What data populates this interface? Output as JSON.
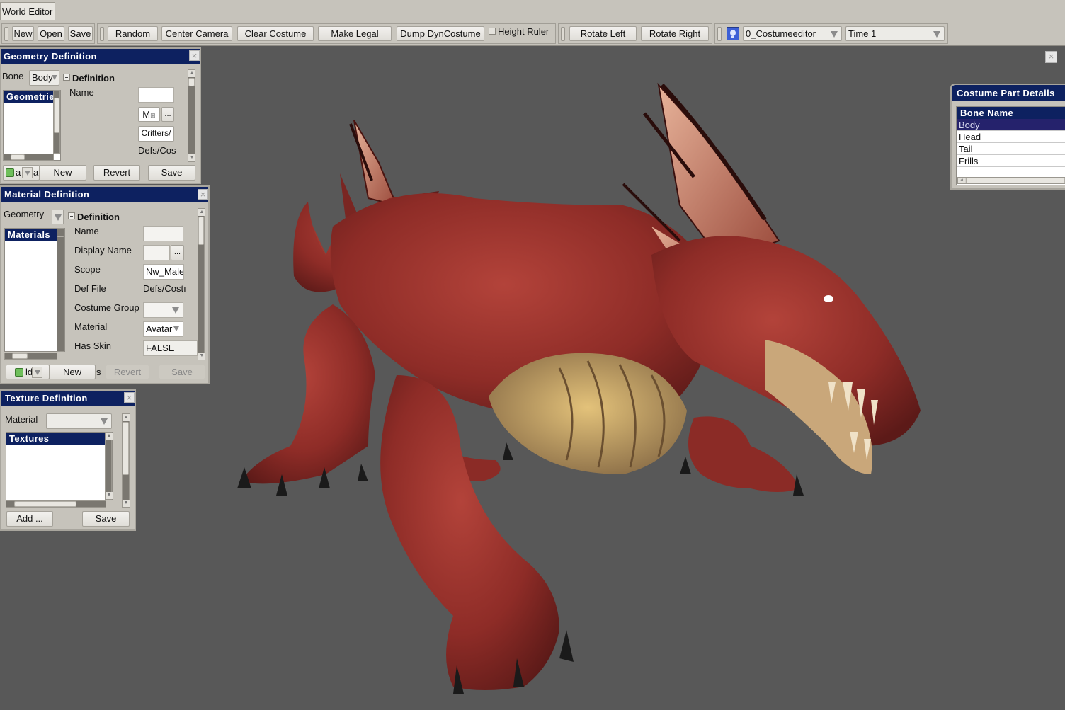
{
  "window": {
    "title_tab": "World Editor"
  },
  "toolbar": {
    "file": {
      "new": "New",
      "open": "Open",
      "save": "Save"
    },
    "actions": {
      "random": "Random",
      "center_camera": "Center Camera",
      "clear_costume": "Clear Costume",
      "make_legal": "Make Legal",
      "dump_dyncostume": "Dump DynCostume",
      "height_ruler": "Height Ruler",
      "height_ruler_checked": false
    },
    "rotate": {
      "left": "Rotate Left",
      "right": "Rotate Right"
    },
    "scene": {
      "icon": "lightbulb-icon",
      "costume_select": "0_Costumeeditor",
      "time_select": "Time 1"
    }
  },
  "geometry_panel": {
    "title": "Geometry Definition",
    "bone_label": "Bone",
    "bone_value": "Body",
    "list_header": "Geometries",
    "section": "Definition",
    "name_label": "Name",
    "name_value": "",
    "m_button": "M",
    "ellipsis": "...",
    "path_button": "Critters/",
    "path_text": "Defs/Cos",
    "footer_a": "a",
    "footer_al": "al",
    "new": "New",
    "revert": "Revert",
    "save": "Save"
  },
  "material_panel": {
    "title": "Material Definition",
    "geometry_label": "Geometry",
    "list_header": "Materials",
    "section": "Definition",
    "fields": {
      "name_label": "Name",
      "display_name_label": "Display Name",
      "scope_label": "Scope",
      "scope_value": "Nw_Male",
      "def_file_label": "Def File",
      "def_file_value": "Defs/Costı",
      "costume_group_label": "Costume Group",
      "material_label": "Material",
      "material_value": "Avatar",
      "has_skin_label": "Has Skin",
      "has_skin_value": "FALSE"
    },
    "ellipsis": "...",
    "footer_ld": "ld",
    "footer_s": "s",
    "new": "New",
    "revert": "Revert",
    "save": "Save"
  },
  "texture_panel": {
    "title": "Texture Definition",
    "material_label": "Material",
    "list_header": "Textures",
    "add": "Add ...",
    "save": "Save"
  },
  "costume_part_panel": {
    "title": "Costume Part Details",
    "column_header": "Bone Name",
    "bones": [
      "Body",
      "Head",
      "Tail",
      "Frills"
    ],
    "selected": "Body"
  },
  "viewport": {
    "subject": "red dragon 3D model",
    "close": "×"
  },
  "colors": {
    "title_bar": "#0d2160",
    "panel_bg": "#c6c3bb",
    "viewport_bg": "#585858",
    "selected_row": "#25226c"
  }
}
